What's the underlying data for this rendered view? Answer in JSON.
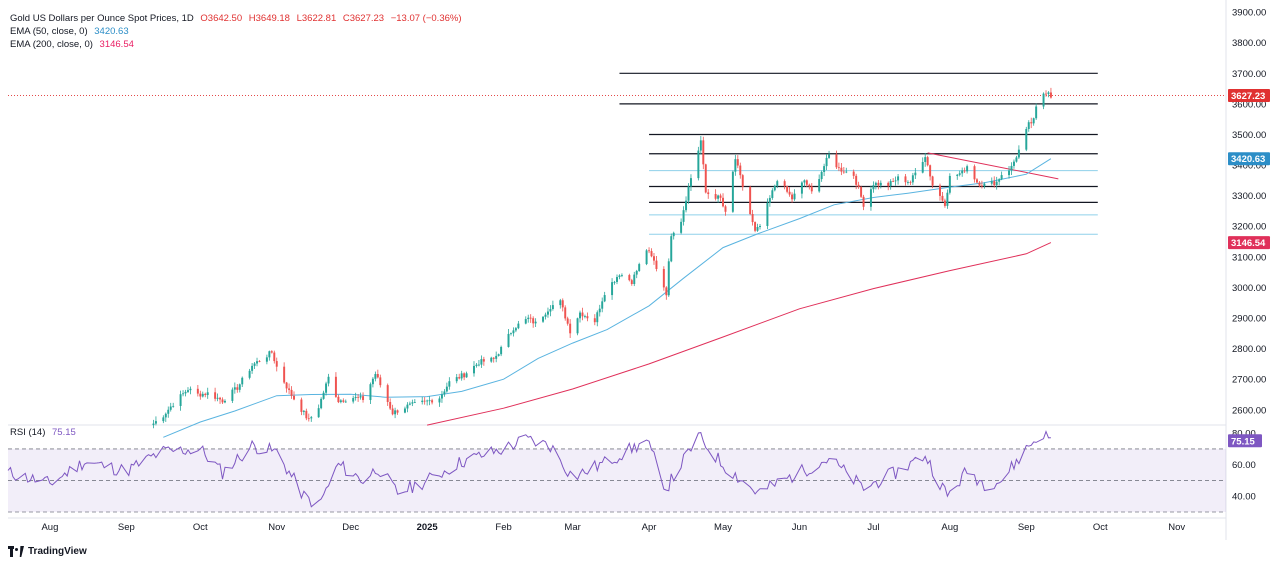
{
  "legend": {
    "title": "Gold US Dollars per Ounce Spot Prices, 1D",
    "o": "O3642.50",
    "h": "H3649.18",
    "l": "L3622.81",
    "c": "C3627.23",
    "chg": "−13.07 (−0.36%)",
    "ema50_label": "EMA (50, close, 0)",
    "ema50_value": "3420.63",
    "ema200_label": "EMA (200, close, 0)",
    "ema200_value": "3146.54"
  },
  "rsi_legend": {
    "label": "RSI (14)",
    "value": "75.15"
  },
  "footer": {
    "brand": "TradingView"
  },
  "colors": {
    "up": "#26a69a",
    "down": "#ef5350",
    "ema50": "#5ab4e0",
    "ema200": "#e0305a",
    "rsi": "#7e57c2",
    "last_price": "#e03131"
  },
  "chart_data": {
    "type": "candlestick",
    "title": "Gold US Dollars per Ounce Spot Prices, 1D",
    "xlabel": "",
    "ylabel": "",
    "ylim": [
      2560,
      3920
    ],
    "y_ticks": [
      2600,
      2700,
      2800,
      2900,
      3000,
      3100,
      3200,
      3300,
      3400,
      3500,
      3600,
      3700,
      3800,
      3900
    ],
    "x_tick_labels": [
      "Aug",
      "Sep",
      "Oct",
      "Nov",
      "Dec",
      "2025",
      "Feb",
      "Mar",
      "Apr",
      "May",
      "Jun",
      "Jul",
      "Aug",
      "Sep",
      "Oct",
      "Nov"
    ],
    "x_tick_dates": [
      "2024-08-01",
      "2024-09-01",
      "2024-10-01",
      "2024-11-01",
      "2024-12-01",
      "2025-01-01",
      "2025-02-01",
      "2025-03-01",
      "2025-04-01",
      "2025-05-01",
      "2025-06-01",
      "2025-07-01",
      "2025-08-01",
      "2025-09-01",
      "2025-10-01",
      "2025-11-01"
    ],
    "price_path": [
      [
        "2024-09-12",
        2555
      ],
      [
        "2024-09-16",
        2582
      ],
      [
        "2024-09-20",
        2620
      ],
      [
        "2024-09-26",
        2668
      ],
      [
        "2024-09-30",
        2650
      ],
      [
        "2024-10-04",
        2654
      ],
      [
        "2024-10-10",
        2630
      ],
      [
        "2024-10-16",
        2672
      ],
      [
        "2024-10-22",
        2745
      ],
      [
        "2024-10-30",
        2788
      ],
      [
        "2024-11-01",
        2740
      ],
      [
        "2024-11-06",
        2660
      ],
      [
        "2024-11-14",
        2565
      ],
      [
        "2024-11-18",
        2610
      ],
      [
        "2024-11-22",
        2705
      ],
      [
        "2024-11-26",
        2630
      ],
      [
        "2024-12-02",
        2640
      ],
      [
        "2024-12-06",
        2635
      ],
      [
        "2024-12-11",
        2718
      ],
      [
        "2024-12-18",
        2590
      ],
      [
        "2024-12-24",
        2612
      ],
      [
        "2024-12-31",
        2625
      ],
      [
        "2025-01-06",
        2640
      ],
      [
        "2025-01-10",
        2690
      ],
      [
        "2025-01-16",
        2715
      ],
      [
        "2025-01-22",
        2755
      ],
      [
        "2025-01-28",
        2765
      ],
      [
        "2025-01-31",
        2800
      ],
      [
        "2025-02-05",
        2868
      ],
      [
        "2025-02-11",
        2898
      ],
      [
        "2025-02-14",
        2882
      ],
      [
        "2025-02-20",
        2938
      ],
      [
        "2025-02-24",
        2952
      ],
      [
        "2025-02-28",
        2858
      ],
      [
        "2025-03-04",
        2918
      ],
      [
        "2025-03-10",
        2890
      ],
      [
        "2025-03-14",
        2984
      ],
      [
        "2025-03-20",
        3046
      ],
      [
        "2025-03-25",
        3020
      ],
      [
        "2025-03-31",
        3124
      ],
      [
        "2025-04-03",
        3085
      ],
      [
        "2025-04-08",
        2982
      ],
      [
        "2025-04-10",
        3175
      ],
      [
        "2025-04-14",
        3220
      ],
      [
        "2025-04-17",
        3328
      ],
      [
        "2025-04-22",
        3480
      ],
      [
        "2025-04-24",
        3310
      ],
      [
        "2025-04-30",
        3290
      ],
      [
        "2025-05-02",
        3240
      ],
      [
        "2025-05-06",
        3420
      ],
      [
        "2025-05-09",
        3330
      ],
      [
        "2025-05-14",
        3180
      ],
      [
        "2025-05-16",
        3200
      ],
      [
        "2025-05-20",
        3290
      ],
      [
        "2025-05-23",
        3355
      ],
      [
        "2025-05-29",
        3290
      ],
      [
        "2025-06-03",
        3350
      ],
      [
        "2025-06-06",
        3310
      ],
      [
        "2025-06-13",
        3432
      ],
      [
        "2025-06-17",
        3388
      ],
      [
        "2025-06-23",
        3368
      ],
      [
        "2025-06-27",
        3272
      ],
      [
        "2025-07-01",
        3340
      ],
      [
        "2025-07-07",
        3335
      ],
      [
        "2025-07-11",
        3357
      ],
      [
        "2025-07-16",
        3345
      ],
      [
        "2025-07-22",
        3432
      ],
      [
        "2025-07-25",
        3335
      ],
      [
        "2025-07-30",
        3275
      ],
      [
        "2025-08-01",
        3360
      ],
      [
        "2025-08-06",
        3375
      ],
      [
        "2025-08-08",
        3398
      ],
      [
        "2025-08-12",
        3345
      ],
      [
        "2025-08-15",
        3335
      ],
      [
        "2025-08-20",
        3345
      ],
      [
        "2025-08-22",
        3370
      ],
      [
        "2025-08-26",
        3393
      ],
      [
        "2025-08-29",
        3448
      ],
      [
        "2025-09-02",
        3532
      ],
      [
        "2025-09-04",
        3545
      ],
      [
        "2025-09-05",
        3586
      ],
      [
        "2025-09-08",
        3635
      ],
      [
        "2025-09-09",
        3640
      ],
      [
        "2025-09-10",
        3642.5
      ],
      [
        "2025-09-11",
        3627.23
      ]
    ],
    "series": [
      {
        "name": "EMA (50, close, 0)",
        "color": "#5ab4e0",
        "points": [
          [
            "2024-09-16",
            2510
          ],
          [
            "2024-10-01",
            2560
          ],
          [
            "2024-10-15",
            2596
          ],
          [
            "2024-11-01",
            2646
          ],
          [
            "2024-11-15",
            2650
          ],
          [
            "2024-12-01",
            2651
          ],
          [
            "2024-12-15",
            2641
          ],
          [
            "2025-01-01",
            2643
          ],
          [
            "2025-01-15",
            2660
          ],
          [
            "2025-02-01",
            2700
          ],
          [
            "2025-02-15",
            2768
          ],
          [
            "2025-03-01",
            2818
          ],
          [
            "2025-03-15",
            2862
          ],
          [
            "2025-04-01",
            2940
          ],
          [
            "2025-04-15",
            3030
          ],
          [
            "2025-05-01",
            3130
          ],
          [
            "2025-05-15",
            3175
          ],
          [
            "2025-06-01",
            3225
          ],
          [
            "2025-06-15",
            3270
          ],
          [
            "2025-07-01",
            3294
          ],
          [
            "2025-07-15",
            3308
          ],
          [
            "2025-08-01",
            3328
          ],
          [
            "2025-08-15",
            3342
          ],
          [
            "2025-09-01",
            3370
          ],
          [
            "2025-09-11",
            3420.63
          ]
        ]
      },
      {
        "name": "EMA (200, close, 0)",
        "color": "#e0305a",
        "points": [
          [
            "2025-01-01",
            2550
          ],
          [
            "2025-02-01",
            2605
          ],
          [
            "2025-03-01",
            2668
          ],
          [
            "2025-04-01",
            2750
          ],
          [
            "2025-05-01",
            2838
          ],
          [
            "2025-06-01",
            2930
          ],
          [
            "2025-07-01",
            2996
          ],
          [
            "2025-08-01",
            3055
          ],
          [
            "2025-09-01",
            3110
          ],
          [
            "2025-09-11",
            3146.54
          ]
        ]
      }
    ],
    "horizontal_levels": [
      {
        "value": 3700,
        "from": "2025-03-20",
        "color": "#131722"
      },
      {
        "value": 3600,
        "from": "2025-03-20",
        "color": "#131722"
      },
      {
        "value": 3500,
        "from": "2025-04-01",
        "color": "#131722"
      },
      {
        "value": 3437,
        "from": "2025-04-01",
        "color": "#131722"
      },
      {
        "value": 3382,
        "from": "2025-04-01",
        "color": "#8fd0ea"
      },
      {
        "value": 3330,
        "from": "2025-04-01",
        "color": "#131722"
      },
      {
        "value": 3278,
        "from": "2025-04-01",
        "color": "#131722"
      },
      {
        "value": 3237,
        "from": "2025-04-01",
        "color": "#8fd0ea"
      },
      {
        "value": 3174,
        "from": "2025-04-01",
        "color": "#8fd0ea"
      }
    ],
    "trendline": {
      "from": [
        "2025-07-23",
        3440
      ],
      "to": [
        "2025-09-14",
        3355
      ],
      "color": "#e0305a"
    },
    "last_price": {
      "value": 3627.23,
      "label": "3627.23"
    },
    "price_labels": [
      {
        "label": "3627.23",
        "value": 3627.23,
        "color": "#e03131"
      },
      {
        "label": "3420.63",
        "value": 3420.63,
        "color": "#2c8ec7"
      },
      {
        "label": "3146.54",
        "value": 3146.54,
        "color": "#e0305a"
      }
    ],
    "rsi": {
      "name": "RSI (14)",
      "last": 75.15,
      "ylim": [
        30,
        82
      ],
      "y_ticks": [
        40,
        60,
        80
      ],
      "y_tick_labels": [
        "40.00",
        "60.00",
        "80.00"
      ],
      "band": [
        30,
        70
      ],
      "mid_line": 50,
      "path": [
        [
          "2024-07-15",
          55
        ],
        [
          "2024-08-01",
          48
        ],
        [
          "2024-08-15",
          62
        ],
        [
          "2024-09-01",
          56
        ],
        [
          "2024-09-15",
          68
        ],
        [
          "2024-10-01",
          70
        ],
        [
          "2024-10-10",
          55
        ],
        [
          "2024-10-22",
          72
        ],
        [
          "2024-11-01",
          68
        ],
        [
          "2024-11-12",
          40
        ],
        [
          "2024-11-18",
          34
        ],
        [
          "2024-11-26",
          60
        ],
        [
          "2024-12-06",
          50
        ],
        [
          "2024-12-12",
          58
        ],
        [
          "2024-12-20",
          42
        ],
        [
          "2025-01-01",
          50
        ],
        [
          "2025-01-15",
          62
        ],
        [
          "2025-02-01",
          70
        ],
        [
          "2025-02-10",
          76
        ],
        [
          "2025-02-20",
          72
        ],
        [
          "2025-03-01",
          52
        ],
        [
          "2025-03-15",
          62
        ],
        [
          "2025-03-31",
          75
        ],
        [
          "2025-04-08",
          45
        ],
        [
          "2025-04-21",
          78
        ],
        [
          "2025-05-01",
          60
        ],
        [
          "2025-05-15",
          42
        ],
        [
          "2025-06-01",
          55
        ],
        [
          "2025-06-13",
          64
        ],
        [
          "2025-06-27",
          45
        ],
        [
          "2025-07-10",
          55
        ],
        [
          "2025-07-22",
          66
        ],
        [
          "2025-07-31",
          40
        ],
        [
          "2025-08-08",
          56
        ],
        [
          "2025-08-15",
          48
        ],
        [
          "2025-08-22",
          50
        ],
        [
          "2025-09-02",
          72
        ],
        [
          "2025-09-08",
          80
        ],
        [
          "2025-09-11",
          75.15
        ]
      ]
    }
  }
}
